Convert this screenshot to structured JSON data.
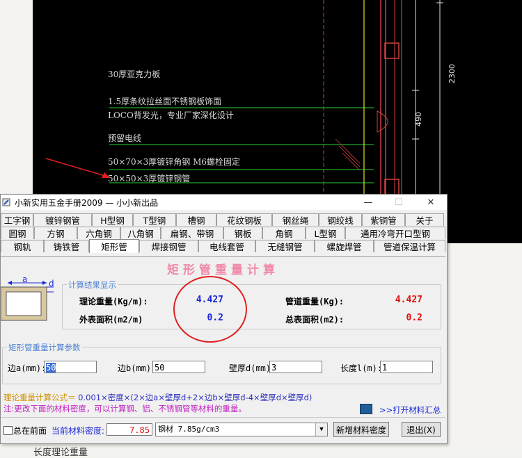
{
  "background": {
    "cad_labels": [
      "30厚亚克力板",
      "1.5厚条纹拉丝面不锈钢板饰面",
      "LOCO背发光，专业厂家深化设计",
      "预留电线",
      "50×70×3厚镀锌角钢 M6螺栓固定",
      "50×50×3厚镀锌钢管"
    ],
    "dim_2300": "2300",
    "dim_490": "490",
    "doc_text": "长度理论重量"
  },
  "window": {
    "title": "小新实用五金手册2009 — 小小新出品",
    "min_symbol": "—",
    "max_symbol": "☐",
    "close_symbol": "✕"
  },
  "tabs": {
    "row1": [
      "工字钢",
      "镀锌钢管",
      "H型钢",
      "T型钢",
      "槽钢",
      "花纹钢板",
      "钢丝绳",
      "钢绞线",
      "紫铜管",
      "关于"
    ],
    "row2": [
      "圆钢",
      "方钢",
      "六角钢",
      "八角钢",
      "扁钢、带钢",
      "钢板",
      "角钢",
      "L型钢",
      "通用冷弯开口型钢"
    ],
    "row3": [
      "钢轨",
      "铸铁管",
      "矩形管",
      "焊接钢管",
      "电线套管",
      "无缝钢管",
      "螺旋焊管",
      "管道保温计算"
    ],
    "active": "矩形管"
  },
  "panel": {
    "heading": "矩形管重量计算",
    "fig_label_a": "a",
    "fig_label_d": "d",
    "results": {
      "title": "计算结果显示",
      "theory_label": "理论重量(Kg/m):",
      "theory_value": "4.427",
      "area_label": "外表面积(m2/m)",
      "area_value": "0.2",
      "pipe_label": "管道重量(Kg):",
      "pipe_value": "4.427",
      "total_label": "总表面积(m2):",
      "total_value": "0.2"
    },
    "params": {
      "title": "矩形管重量计算参数",
      "a_label": "边a(mm):",
      "a_value": "50",
      "b_label": "边b(mm):",
      "b_value": "50",
      "d_label": "壁厚d(mm)",
      "d_value": "3",
      "l_label": "长度l(m):",
      "l_value": "1"
    },
    "formula_key": "理论重量计算公式＝",
    "formula_body": " 0.001×密度×(2×边a×壁厚d+2×边b×壁厚d-4×壁厚d×壁厚d)",
    "note": "注:更改下面的材料密度，可以计算钢、铝、不锈钢管等材料的重量。",
    "summary_link": ">>打开材料汇总"
  },
  "bottom": {
    "ontop_label": "总在前面",
    "density_label": "当前材料密度:",
    "density_value": "7.85",
    "material_value": "钢材 7.85g/cm3",
    "add_density_button": "新增材料密度",
    "exit_button": "退出(X)"
  },
  "colors": {
    "heading": "#f08aa8",
    "value_blue": "#1a24d8",
    "value_red": "#e01010",
    "group_title": "#4a7fd0",
    "annotation_circle": "#e02020"
  }
}
